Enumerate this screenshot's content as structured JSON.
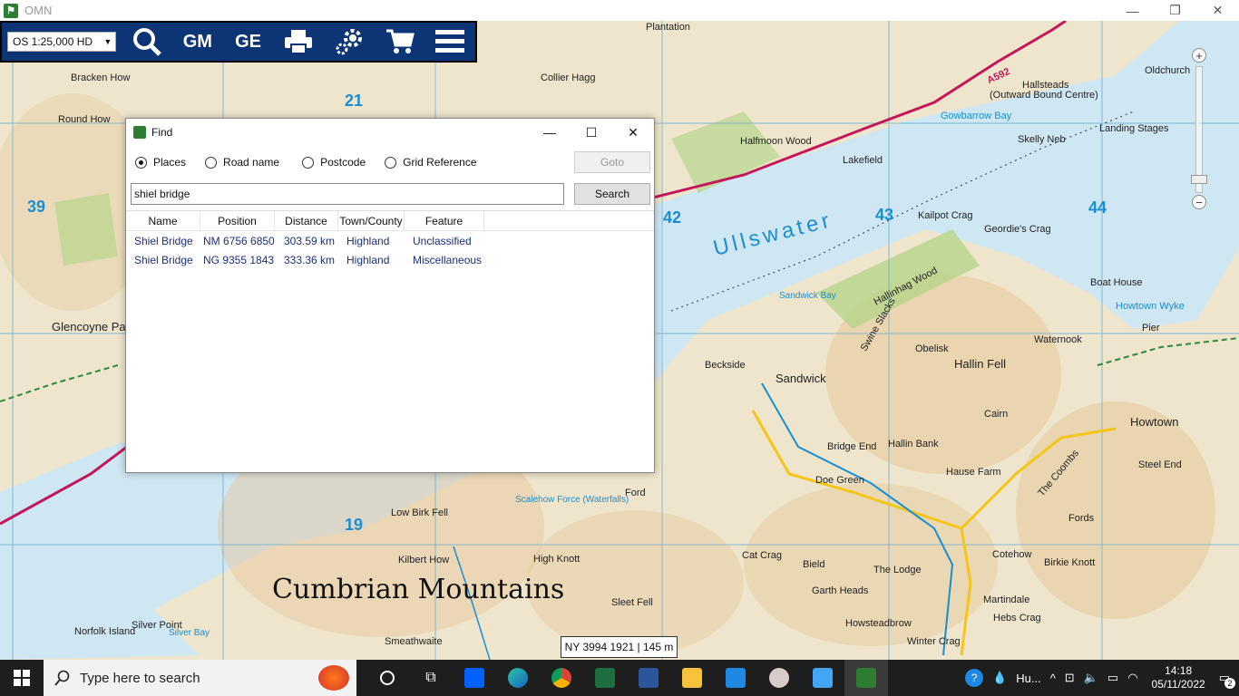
{
  "app": {
    "title": "OMN",
    "minimize": "—",
    "maximize": "❐",
    "close": "✕"
  },
  "toolbar": {
    "scale": "OS 1:25,000 HD",
    "buttons": [
      {
        "name": "search",
        "label": ""
      },
      {
        "name": "gm",
        "label": "GM"
      },
      {
        "name": "ge",
        "label": "GE"
      },
      {
        "name": "print",
        "label": ""
      },
      {
        "name": "settings",
        "label": ""
      },
      {
        "name": "cart",
        "label": ""
      },
      {
        "name": "menu",
        "label": ""
      }
    ]
  },
  "map": {
    "grid_numbers": [
      "21",
      "39",
      "42",
      "43",
      "44",
      "19"
    ],
    "region": "Cumbrian Mountains",
    "lake": "Ullswater",
    "places": [
      "Plantation",
      "Hallsteads",
      "(Outward Bound Centre)",
      "Oldchurch",
      "Gowbarrow Bay",
      "Skelly Neb",
      "Landing Stages",
      "Halfmoon Wood",
      "Lakefield",
      "Bracken How",
      "Round How",
      "Kailpot Crag",
      "Geordie's Crag",
      "Boat House",
      "Howtown Wyke",
      "Sandwick Bay",
      "Hallinhag Wood",
      "Swine Slacks",
      "Obelisk",
      "Hallin Fell",
      "Waternook",
      "Beckside",
      "Sandwick",
      "Cairn",
      "Howtown",
      "Bridge End",
      "Hallin Bank",
      "Hause Farm",
      "Doe Green",
      "The Coombs",
      "Glencoyne Park",
      "Low Birk Fell",
      "Kilbert How",
      "Sleet Fell",
      "The Lodge",
      "Martindale",
      "Cotehow",
      "Birkie Knott",
      "Ford",
      "Pier",
      "Norfolk Island",
      "Silver Point",
      "Silver Bay",
      "Smeathwaite",
      "Steel End",
      "Collier Hagg",
      "Cat Crag",
      "Scalehow Force (Waterfalls)",
      "High Knott",
      "Beckside",
      "Howsteadbrow",
      "Winter Crag",
      "Hebs Crag",
      "Bield",
      "Garth Heads",
      "Fords"
    ],
    "road": "A592"
  },
  "find_dialog": {
    "title": "Find",
    "radios": [
      {
        "label": "Places",
        "checked": true
      },
      {
        "label": "Road name",
        "checked": false
      },
      {
        "label": "Postcode",
        "checked": false
      },
      {
        "label": "Grid Reference",
        "checked": false
      }
    ],
    "goto_label": "Goto",
    "search_value": "shiel bridge",
    "search_label": "Search",
    "columns": [
      "Name",
      "Position",
      "Distance",
      "Town/County",
      "Feature"
    ],
    "rows": [
      {
        "name": "Shiel Bridge",
        "position": "NM 6756 6850",
        "distance": "303.59 km",
        "county": "Highland",
        "feature": "Unclassified"
      },
      {
        "name": "Shiel Bridge",
        "position": "NG 9355 1843",
        "distance": "333.36 km",
        "county": "Highland",
        "feature": "Miscellaneous"
      }
    ]
  },
  "coord_readout": "NY 3994 1921 | 145 m",
  "taskbar": {
    "search_placeholder": "Type here to search",
    "tray_app_label": "Hu...",
    "time": "14:18",
    "date": "05/11/2022",
    "notifications": "2"
  },
  "colors": {
    "toolbar_bg": "#0d3474",
    "water": "#cfe6f3",
    "link_blue": "#1a2e80",
    "grid_blue": "#1a8fd0"
  }
}
